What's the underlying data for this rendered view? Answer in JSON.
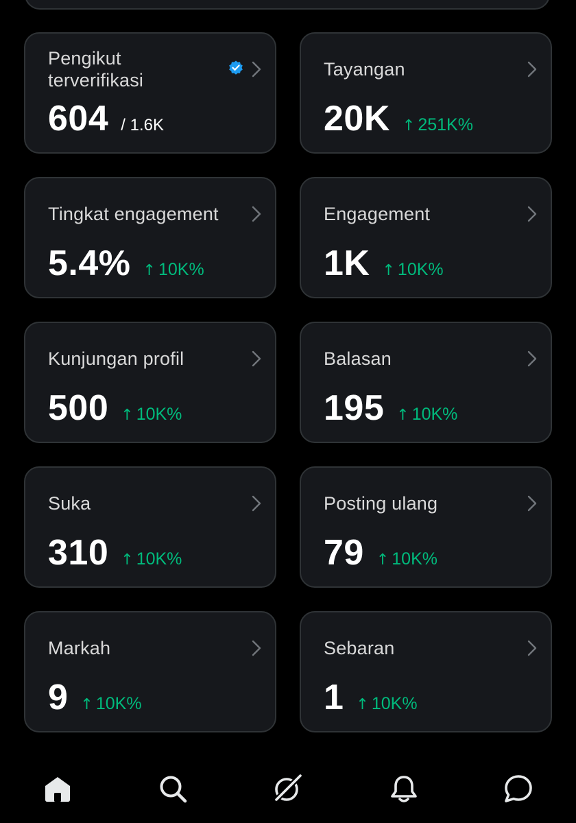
{
  "cards": [
    {
      "title": "Pengikut terverifikasi",
      "value": "604",
      "sub": "/ 1.6K",
      "delta": "",
      "verified": true
    },
    {
      "title": "Tayangan",
      "value": "20K",
      "sub": "",
      "delta": "251K%"
    },
    {
      "title": "Tingkat engagement",
      "value": "5.4%",
      "sub": "",
      "delta": "10K%"
    },
    {
      "title": "Engagement",
      "value": "1K",
      "sub": "",
      "delta": "10K%"
    },
    {
      "title": "Kunjungan profil",
      "value": "500",
      "sub": "",
      "delta": "10K%"
    },
    {
      "title": "Balasan",
      "value": "195",
      "sub": "",
      "delta": "10K%"
    },
    {
      "title": "Suka",
      "value": "310",
      "sub": "",
      "delta": "10K%"
    },
    {
      "title": "Posting ulang",
      "value": "79",
      "sub": "",
      "delta": "10K%"
    },
    {
      "title": "Markah",
      "value": "9",
      "sub": "",
      "delta": "10K%"
    },
    {
      "title": "Sebaran",
      "value": "1",
      "sub": "",
      "delta": "10K%"
    }
  ],
  "delta_arrow": "↑",
  "colors": {
    "background": "#000000",
    "card": "#16181c",
    "card_border": "#2f3336",
    "positive": "#00ba7c",
    "verified": "#1d9bf0"
  },
  "nav": {
    "icons": [
      "home-icon",
      "search-icon",
      "grok-icon",
      "notifications-icon",
      "messages-icon"
    ]
  }
}
